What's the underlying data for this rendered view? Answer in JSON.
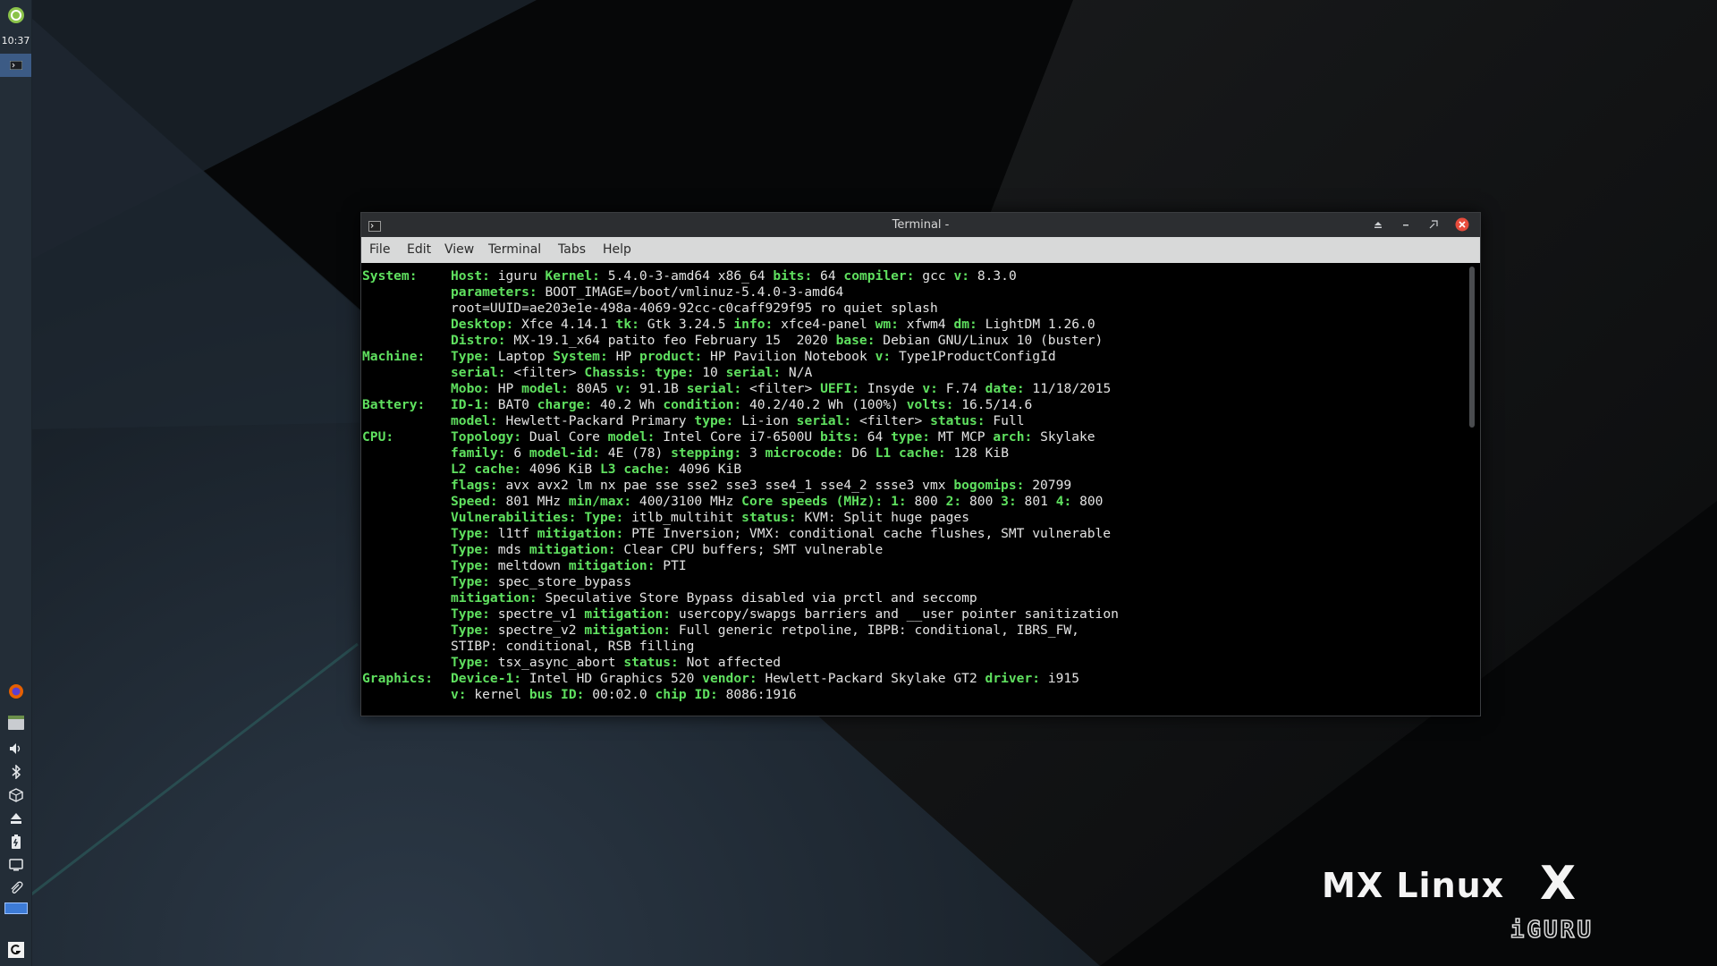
{
  "panel": {
    "clock": "10:37",
    "icons": [
      "whisker-menu-icon",
      "terminal-task-icon",
      "firefox-icon",
      "file-manager-icon",
      "volume-icon",
      "bluetooth-icon",
      "package-updater-icon",
      "eject-icon",
      "battery-icon",
      "display-icon",
      "clipboard-icon",
      "workspace-switcher-icon",
      "logout-icon"
    ]
  },
  "terminal": {
    "title": "Terminal -",
    "menu": [
      "File",
      "Edit",
      "View",
      "Terminal",
      "Tabs",
      "Help"
    ],
    "lines": [
      {
        "section": "System:",
        "segs": [
          [
            "Host:",
            "iguru"
          ],
          [
            "Kernel:",
            "5.4.0-3-amd64 x86_64"
          ],
          [
            "bits:",
            "64"
          ],
          [
            "compiler:",
            "gcc"
          ],
          [
            "v:",
            "8.3.0"
          ]
        ]
      },
      {
        "section": "",
        "segs": [
          [
            "parameters:",
            "BOOT_IMAGE=/boot/vmlinuz-5.4.0-3-amd64"
          ]
        ]
      },
      {
        "section": "",
        "segs": [
          [
            "",
            "root=UUID=ae203e1e-498a-4069-92cc-c0caff929f95 ro quiet splash"
          ]
        ]
      },
      {
        "section": "",
        "segs": [
          [
            "Desktop:",
            "Xfce 4.14.1"
          ],
          [
            "tk:",
            "Gtk 3.24.5"
          ],
          [
            "info:",
            "xfce4-panel"
          ],
          [
            "wm:",
            "xfwm4"
          ],
          [
            "dm:",
            "LightDM 1.26.0"
          ]
        ]
      },
      {
        "section": "",
        "segs": [
          [
            "Distro:",
            "MX-19.1_x64 patito feo February 15  2020"
          ],
          [
            "base:",
            "Debian GNU/Linux 10 (buster)"
          ]
        ]
      },
      {
        "section": "Machine:",
        "segs": [
          [
            "Type:",
            "Laptop"
          ],
          [
            "System:",
            "HP"
          ],
          [
            "product:",
            "HP Pavilion Notebook"
          ],
          [
            "v:",
            "Type1ProductConfigId"
          ]
        ]
      },
      {
        "section": "",
        "segs": [
          [
            "serial:",
            "<filter>"
          ],
          [
            "Chassis:",
            ""
          ],
          [
            "type:",
            "10"
          ],
          [
            "serial:",
            "N/A"
          ]
        ]
      },
      {
        "section": "",
        "segs": [
          [
            "Mobo:",
            "HP"
          ],
          [
            "model:",
            "80A5"
          ],
          [
            "v:",
            "91.1B"
          ],
          [
            "serial:",
            "<filter>"
          ],
          [
            "UEFI:",
            "Insyde"
          ],
          [
            "v:",
            "F.74"
          ],
          [
            "date:",
            "11/18/2015"
          ]
        ]
      },
      {
        "section": "Battery:",
        "segs": [
          [
            "ID-1:",
            "BAT0"
          ],
          [
            "charge:",
            "40.2 Wh"
          ],
          [
            "condition:",
            "40.2/40.2 Wh (100%)"
          ],
          [
            "volts:",
            "16.5/14.6"
          ]
        ]
      },
      {
        "section": "",
        "segs": [
          [
            "model:",
            "Hewlett-Packard Primary"
          ],
          [
            "type:",
            "Li-ion"
          ],
          [
            "serial:",
            "<filter>"
          ],
          [
            "status:",
            "Full"
          ]
        ]
      },
      {
        "section": "CPU:",
        "segs": [
          [
            "Topology:",
            "Dual Core"
          ],
          [
            "model:",
            "Intel Core i7-6500U"
          ],
          [
            "bits:",
            "64"
          ],
          [
            "type:",
            "MT MCP"
          ],
          [
            "arch:",
            "Skylake"
          ]
        ]
      },
      {
        "section": "",
        "segs": [
          [
            "family:",
            "6"
          ],
          [
            "model-id:",
            "4E (78)"
          ],
          [
            "stepping:",
            "3"
          ],
          [
            "microcode:",
            "D6"
          ],
          [
            "L1 cache:",
            "128 KiB"
          ]
        ]
      },
      {
        "section": "",
        "segs": [
          [
            "L2 cache:",
            "4096 KiB"
          ],
          [
            "L3 cache:",
            "4096 KiB"
          ]
        ]
      },
      {
        "section": "",
        "segs": [
          [
            "flags:",
            "avx avx2 lm nx pae sse sse2 sse3 sse4_1 sse4_2 ssse3 vmx"
          ],
          [
            "bogomips:",
            "20799"
          ]
        ]
      },
      {
        "section": "",
        "segs": [
          [
            "Speed:",
            "801 MHz"
          ],
          [
            "min/max:",
            "400/3100 MHz"
          ],
          [
            "Core speeds (MHz):",
            ""
          ],
          [
            "1:",
            "800"
          ],
          [
            "2:",
            "800"
          ],
          [
            "3:",
            "801"
          ],
          [
            "4:",
            "800"
          ]
        ]
      },
      {
        "section": "",
        "segs": [
          [
            "Vulnerabilities:",
            ""
          ],
          [
            "Type:",
            "itlb_multihit"
          ],
          [
            "status:",
            "KVM: Split huge pages"
          ]
        ]
      },
      {
        "section": "",
        "segs": [
          [
            "Type:",
            "l1tf"
          ],
          [
            "mitigation:",
            "PTE Inversion; VMX: conditional cache flushes, SMT vulnerable"
          ]
        ]
      },
      {
        "section": "",
        "segs": [
          [
            "Type:",
            "mds"
          ],
          [
            "mitigation:",
            "Clear CPU buffers; SMT vulnerable"
          ]
        ]
      },
      {
        "section": "",
        "segs": [
          [
            "Type:",
            "meltdown"
          ],
          [
            "mitigation:",
            "PTI"
          ]
        ]
      },
      {
        "section": "",
        "segs": [
          [
            "Type:",
            "spec_store_bypass"
          ]
        ]
      },
      {
        "section": "",
        "segs": [
          [
            "mitigation:",
            "Speculative Store Bypass disabled via prctl and seccomp"
          ]
        ]
      },
      {
        "section": "",
        "segs": [
          [
            "Type:",
            "spectre_v1"
          ],
          [
            "mitigation:",
            "usercopy/swapgs barriers and __user pointer sanitization"
          ]
        ]
      },
      {
        "section": "",
        "segs": [
          [
            "Type:",
            "spectre_v2"
          ],
          [
            "mitigation:",
            "Full generic retpoline, IBPB: conditional, IBRS_FW,"
          ]
        ]
      },
      {
        "section": "",
        "segs": [
          [
            "",
            "STIBP: conditional, RSB filling"
          ]
        ]
      },
      {
        "section": "",
        "segs": [
          [
            "Type:",
            "tsx_async_abort"
          ],
          [
            "status:",
            "Not affected"
          ]
        ]
      },
      {
        "section": "Graphics:",
        "segs": [
          [
            "Device-1:",
            "Intel HD Graphics 520"
          ],
          [
            "vendor:",
            "Hewlett-Packard Skylake GT2"
          ],
          [
            "driver:",
            "i915"
          ]
        ]
      },
      {
        "section": "",
        "segs": [
          [
            "v:",
            "kernel"
          ],
          [
            "bus ID:",
            "00:02.0"
          ],
          [
            "chip ID:",
            "8086:1916"
          ]
        ]
      }
    ]
  },
  "wallpaper": {
    "brand": "MX Linux",
    "logo_mark": "X",
    "watermark": "iGURU"
  },
  "colors": {
    "term_key": "#5fe05f",
    "term_text": "#e3e3e3",
    "panel_bg": "#232d37",
    "close_button": "#e74c3c"
  }
}
